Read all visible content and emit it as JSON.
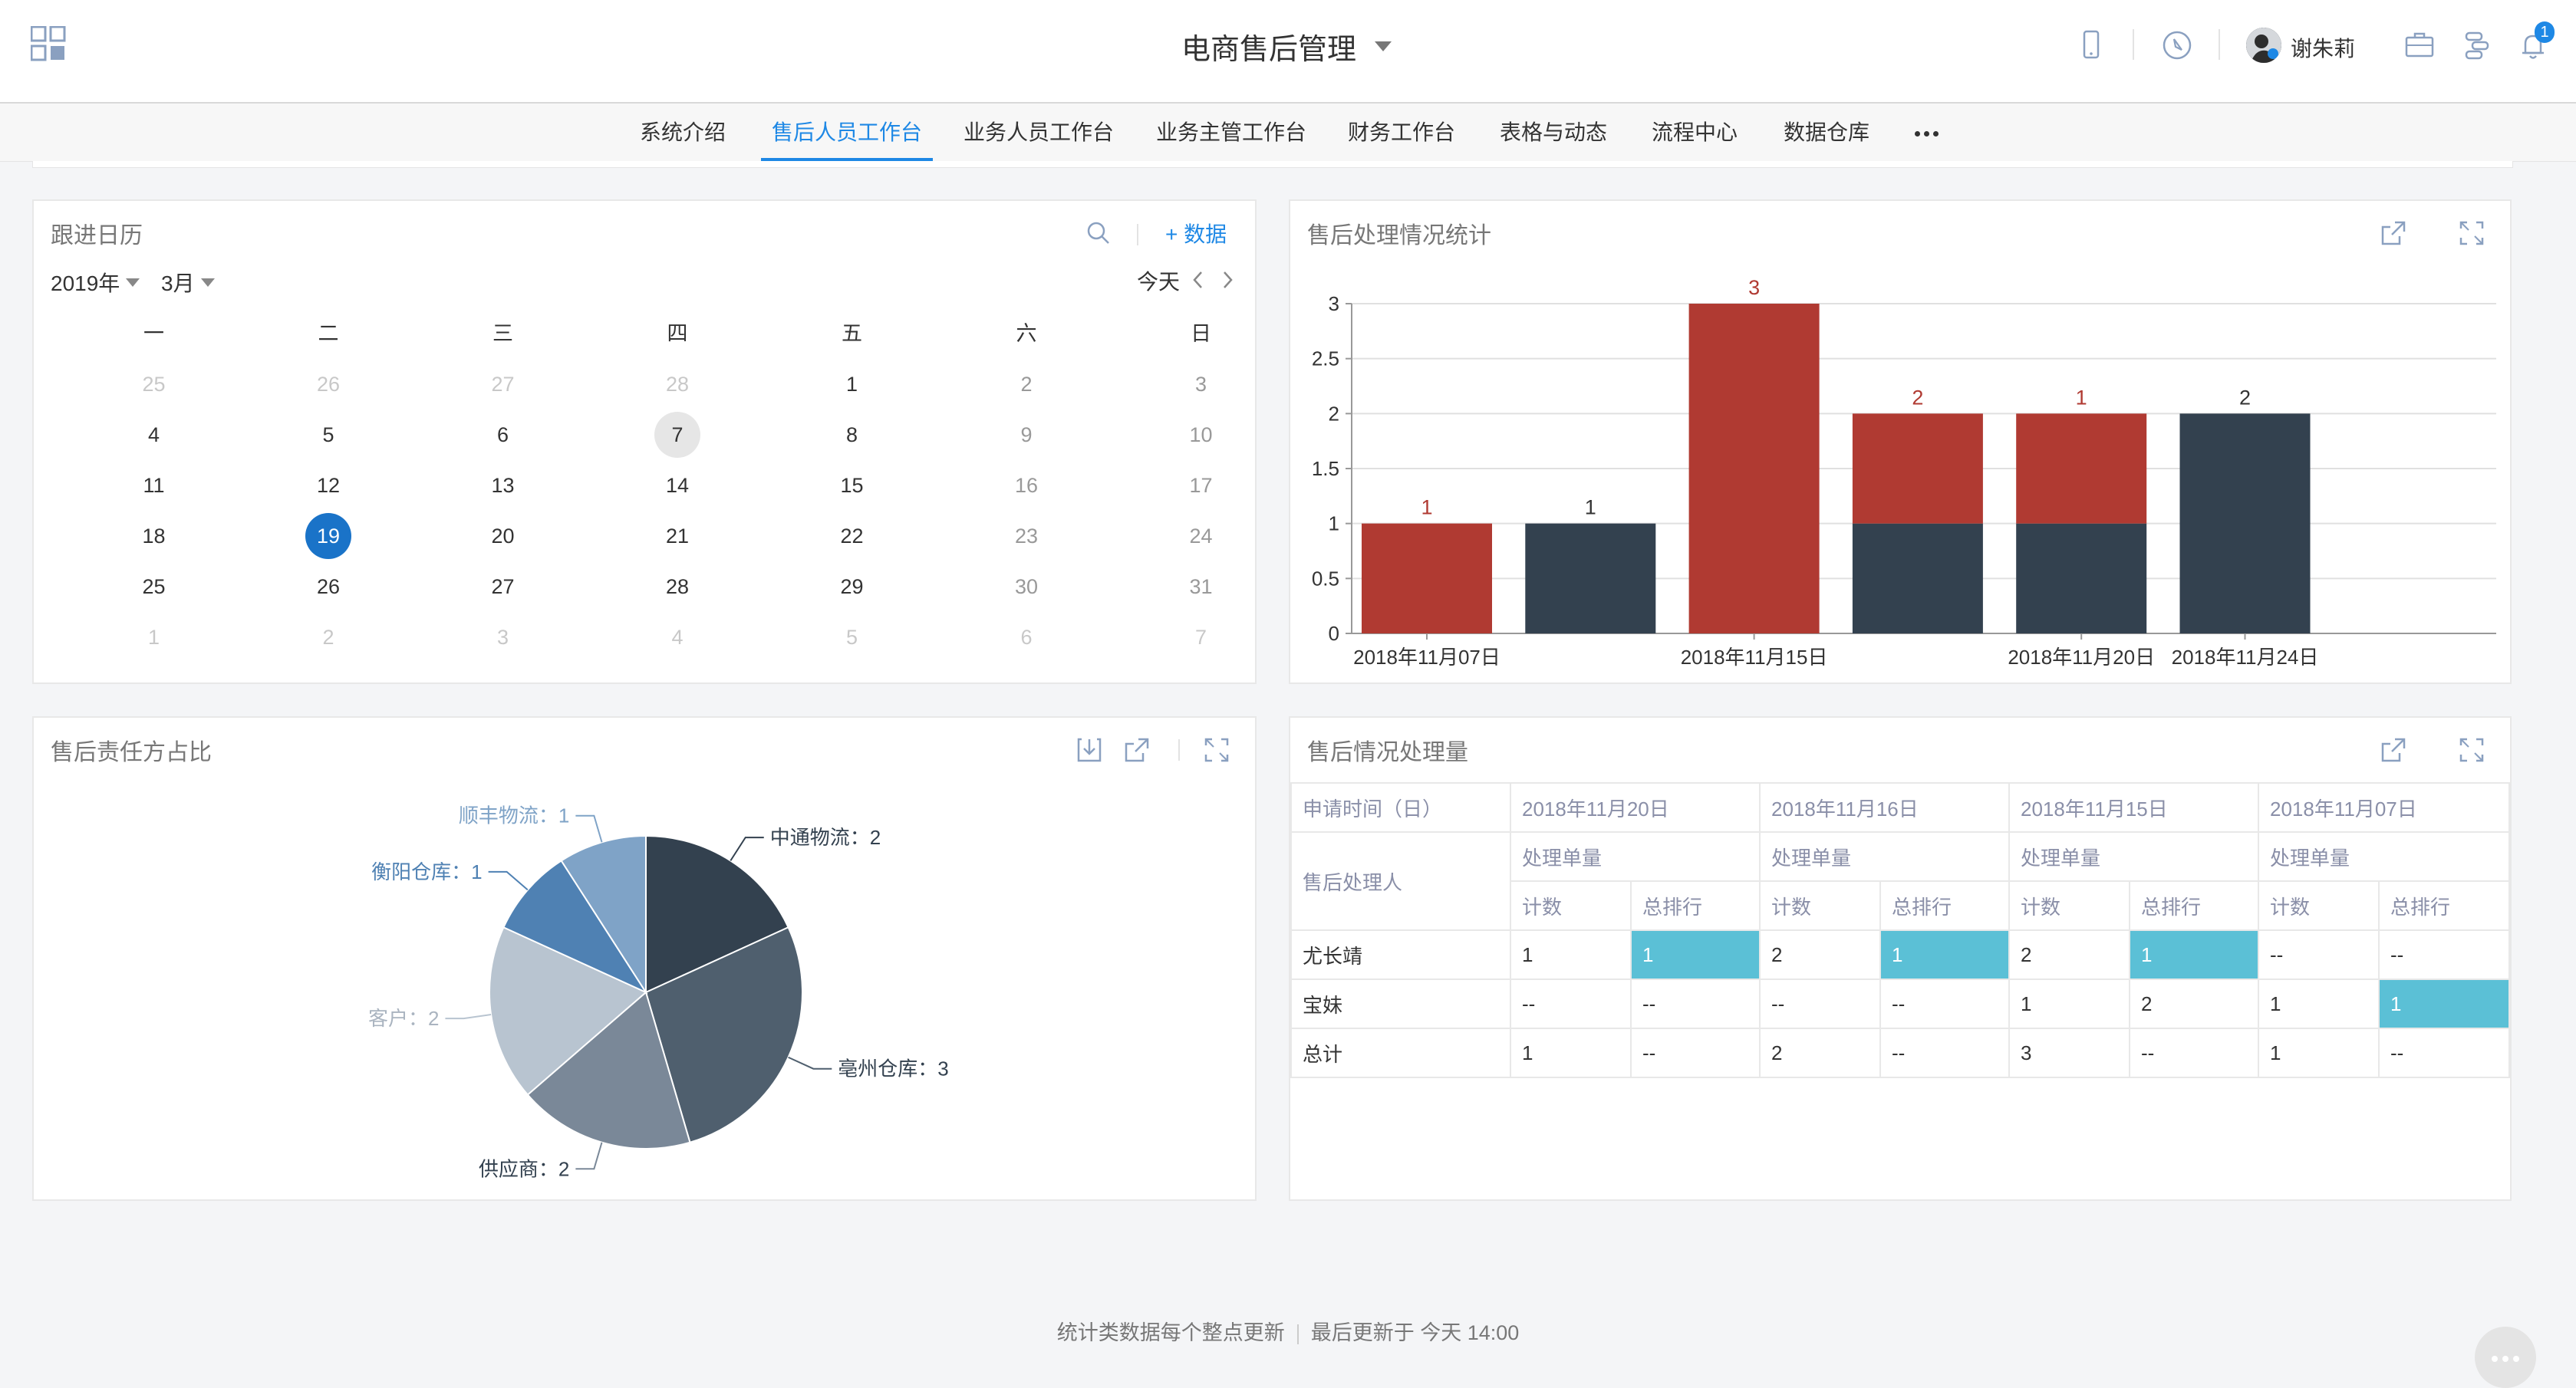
{
  "header": {
    "title": "电商售后管理",
    "user_name": "谢朱莉",
    "notification_count": "1"
  },
  "nav": {
    "tabs": [
      "系统介绍",
      "售后人员工作台",
      "业务人员工作台",
      "业务主管工作台",
      "财务工作台",
      "表格与动态",
      "流程中心",
      "数据仓库"
    ],
    "active_tab": "售后人员工作台"
  },
  "calendar": {
    "title": "跟进日历",
    "add_label": "+ 数据",
    "year": "2019年",
    "month": "3月",
    "today_label": "今天",
    "weekdays": [
      "一",
      "二",
      "三",
      "四",
      "五",
      "六",
      "日"
    ],
    "weeks": [
      [
        "25",
        "26",
        "27",
        "28",
        "1",
        "2",
        "3"
      ],
      [
        "4",
        "5",
        "6",
        "7",
        "8",
        "9",
        "10"
      ],
      [
        "11",
        "12",
        "13",
        "14",
        "15",
        "16",
        "17"
      ],
      [
        "18",
        "19",
        "20",
        "21",
        "22",
        "23",
        "24"
      ],
      [
        "25",
        "26",
        "27",
        "28",
        "29",
        "30",
        "31"
      ],
      [
        "1",
        "2",
        "3",
        "4",
        "5",
        "6",
        "7"
      ]
    ],
    "today_day": "7",
    "selected_day": "19"
  },
  "stats": {
    "title": "售后处理情况统计",
    "chart_data": {
      "type": "bar",
      "stacked": true,
      "categories": [
        "2018年11月07日",
        "2018年11月07日",
        "2018年11月15日",
        "2018年11月15日",
        "2018年11月20日",
        "2018年11月24日"
      ],
      "x_tick_labels": [
        "2018年11月07日",
        "2018年11月15日",
        "2018年11月20日",
        "2018年11月24日"
      ],
      "series": [
        {
          "color": "#b03a32",
          "values": [
            1,
            0,
            3,
            1,
            1,
            0
          ]
        },
        {
          "color": "#33414f",
          "values": [
            0,
            1,
            0,
            1,
            1,
            2
          ]
        }
      ],
      "data_labels": [
        "1",
        "1",
        "3",
        "2",
        "1",
        "2"
      ],
      "data_label_colors": [
        "#b03a32",
        "#333333",
        "#b03a32",
        "#b03a32",
        "#b03a32",
        "#333333"
      ],
      "ylim": [
        0,
        3
      ],
      "y_ticks": [
        "0",
        "0.5",
        "1",
        "1.5",
        "2",
        "2.5",
        "3"
      ],
      "grid": true
    }
  },
  "pie": {
    "title": "售后责任方占比",
    "chart_data": {
      "type": "pie",
      "slices": [
        {
          "label": "中通物流：2",
          "value": 2,
          "color": "#33414f"
        },
        {
          "label": "亳州仓库：3",
          "value": 3,
          "color": "#4f5f6e"
        },
        {
          "label": "供应商：2",
          "value": 2,
          "color": "#7a8898"
        },
        {
          "label": "客户：2",
          "value": 2,
          "color": "#b8c4d0"
        },
        {
          "label": "衡阳仓库：1",
          "value": 1,
          "color": "#4f81b3"
        },
        {
          "label": "顺丰物流：1",
          "value": 1,
          "color": "#7fa3c7"
        }
      ]
    }
  },
  "volume": {
    "title": "售后情况处理量",
    "apply_time_label": "申请时间（日）",
    "handler_label": "售后处理人",
    "dates": [
      "2018年11月20日",
      "2018年11月16日",
      "2018年11月15日",
      "2018年11月07日"
    ],
    "group_label": "处理单量",
    "count_label": "计数",
    "rank_label": "总排行",
    "rows": [
      {
        "name": "尤长靖",
        "cells": [
          "1",
          "1",
          "2",
          "1",
          "2",
          "1",
          "--",
          "--"
        ]
      },
      {
        "name": "宝妹",
        "cells": [
          "--",
          "--",
          "--",
          "--",
          "1",
          "2",
          "1",
          "1"
        ]
      },
      {
        "name": "总计",
        "cells": [
          "1",
          "--",
          "2",
          "--",
          "3",
          "--",
          "1",
          "--"
        ]
      }
    ],
    "highlight_color": "#5bc0d6"
  },
  "footer": {
    "left": "统计类数据每个整点更新",
    "right": "最后更新于 今天 14:00"
  }
}
